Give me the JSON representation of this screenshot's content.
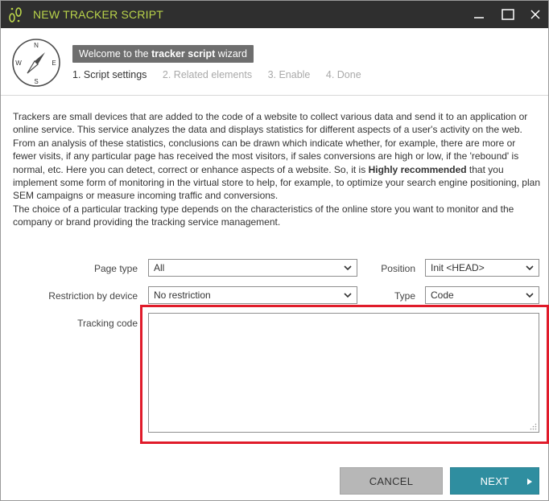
{
  "window": {
    "title": "NEW TRACKER SCRIPT",
    "title_color": "#b9d34a",
    "titlebar_color": "#2f2f2f"
  },
  "header": {
    "welcome_prefix": "Welcome to the ",
    "welcome_bold": "tracker script",
    "welcome_suffix": " wizard",
    "compass_letters": {
      "n": "N",
      "e": "E",
      "s": "S",
      "w": "W"
    },
    "steps": [
      {
        "label": "1. Script settings",
        "active": true
      },
      {
        "label": "2. Related elements",
        "active": false
      },
      {
        "label": "3. Enable",
        "active": false
      },
      {
        "label": "4. Done",
        "active": false
      }
    ]
  },
  "description": {
    "p1_before": "Trackers are small devices that are added to the code of a website to collect various data and send it to an application or online service. This service analyzes the data and displays statistics for different aspects of a user's activity on the web. From an analysis of these statistics, conclusions can be drawn which indicate whether, for example, there are more or fewer visits, if any particular page has received the most visitors, if sales conversions are high or low, if the 'rebound' is normal, etc. Here you can detect, correct or enhance aspects of a website. So, it is ",
    "p1_bold": "Highly recommended",
    "p1_after": " that you implement some form of monitoring in the virtual store to help, for example, to optimize your search engine positioning, plan SEM campaigns or measure incoming traffic and conversions.",
    "p2": "The choice of a particular tracking type depends on the characteristics of the online store you want to monitor and the company or brand providing the tracking service management."
  },
  "form": {
    "page_type": {
      "label": "Page type",
      "value": "All"
    },
    "position": {
      "label": "Position",
      "value": "Init <HEAD>"
    },
    "restriction": {
      "label": "Restriction by device",
      "value": "No restriction"
    },
    "type": {
      "label": "Type",
      "value": "Code"
    },
    "tracking_code": {
      "label": "Tracking code",
      "value": ""
    },
    "highlight_color": "#e01b2a"
  },
  "footer": {
    "cancel_label": "CANCEL",
    "next_label": "NEXT",
    "next_color": "#2f8ea0"
  }
}
